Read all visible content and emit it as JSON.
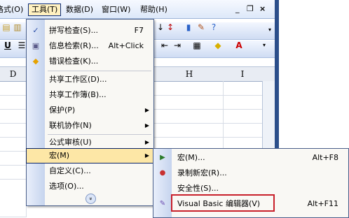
{
  "menubar": {
    "items": [
      {
        "label": "格式(O)"
      },
      {
        "label": "工具(T)"
      },
      {
        "label": "数据(D)"
      },
      {
        "label": "窗口(W)"
      },
      {
        "label": "帮助(H)"
      }
    ],
    "window_controls": {
      "min": "_",
      "restore": "❐",
      "close": "×"
    }
  },
  "toolbar": {
    "bold": "U",
    "col_headers": [
      "D",
      "H",
      "I"
    ]
  },
  "tools_menu": {
    "items": [
      {
        "label": "拼写检查(S)...",
        "shortcut": "F7",
        "icon": "spelling-icon"
      },
      {
        "label": "信息检索(R)...",
        "shortcut": "Alt+Click",
        "icon": "research-icon"
      },
      {
        "label": "错误检查(K)...",
        "shortcut": "",
        "icon": "error-check-icon"
      },
      {
        "label": "共享工作区(D)...",
        "shortcut": ""
      },
      {
        "label": "共享工作簿(B)...",
        "shortcut": ""
      },
      {
        "label": "保护(P)",
        "shortcut": "",
        "submenu": true
      },
      {
        "label": "联机协作(N)",
        "shortcut": "",
        "submenu": true
      },
      {
        "label": "公式审核(U)",
        "shortcut": "",
        "submenu": true
      },
      {
        "label": "宏(M)",
        "shortcut": "",
        "submenu": true,
        "highlighted": true
      },
      {
        "label": "自定义(C)...",
        "shortcut": ""
      },
      {
        "label": "选项(O)...",
        "shortcut": ""
      }
    ],
    "expand": "»"
  },
  "macro_submenu": {
    "items": [
      {
        "label": "宏(M)...",
        "shortcut": "Alt+F8",
        "icon": "run-macro-icon"
      },
      {
        "label": "录制新宏(R)...",
        "shortcut": "",
        "icon": "record-icon"
      },
      {
        "label": "安全性(S)...",
        "shortcut": ""
      },
      {
        "label": "Visual Basic 编辑器(V)",
        "shortcut": "Alt+F11",
        "icon": "vb-editor-icon"
      }
    ]
  }
}
